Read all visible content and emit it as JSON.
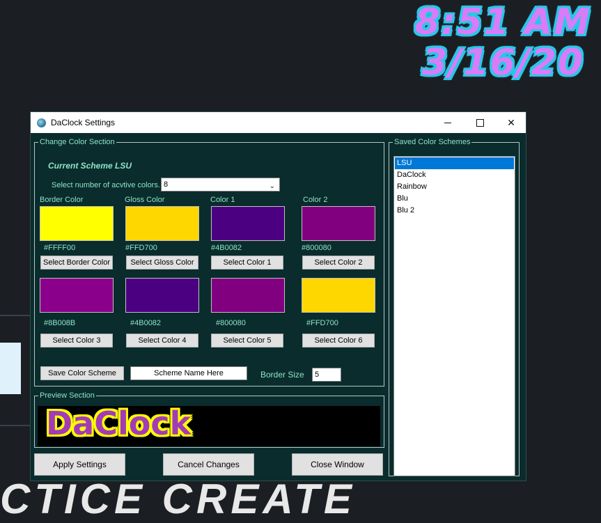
{
  "desktop": {
    "time": "8:51 AM",
    "date": "3/16/20"
  },
  "window": {
    "title": "DaClock Settings"
  },
  "change_section": {
    "legend": "Change Color Section",
    "current_scheme": "Current Scheme LSU",
    "num_colors_label": "Select number of acvtive colors.",
    "num_colors_value": "8",
    "top_labels": [
      "Border Color",
      "Gloss Color",
      "Color 1",
      "Color 2"
    ],
    "swatches": [
      {
        "color": "#FFFF00",
        "hex": "#FFFF00",
        "button": "Select Border Color"
      },
      {
        "color": "#FFD700",
        "hex": "#FFD700",
        "button": "Select Gloss Color"
      },
      {
        "color": "#4B0082",
        "hex": "#4B0082",
        "button": "Select Color 1"
      },
      {
        "color": "#800080",
        "hex": "#800080",
        "button": "Select Color 2"
      },
      {
        "color": "#8B008B",
        "hex": "#8B008B",
        "button": "Select Color 3"
      },
      {
        "color": "#4B0082",
        "hex": "#4B0082",
        "button": "Select Color 4"
      },
      {
        "color": "#800080",
        "hex": "#800080",
        "button": "Select Color 5"
      },
      {
        "color": "#FFD700",
        "hex": "#FFD700",
        "button": "Select  Color 6"
      }
    ],
    "save_button": "Save Color Scheme",
    "scheme_name_value": "Scheme Name Here",
    "border_size_label": "Border Size",
    "border_size_value": "5"
  },
  "preview_section": {
    "legend": "Preview Section",
    "preview_text": "DaClock"
  },
  "saved_section": {
    "legend": "Saved Color Schemes",
    "items": [
      "LSU",
      "DaClock",
      "Rainbow",
      "Blu",
      "Blu 2"
    ],
    "selected_index": 0
  },
  "buttons": {
    "apply": "Apply Settings",
    "cancel": "Cancel Changes",
    "close": "Close Window"
  },
  "background_text": "CTICE  CREATE"
}
